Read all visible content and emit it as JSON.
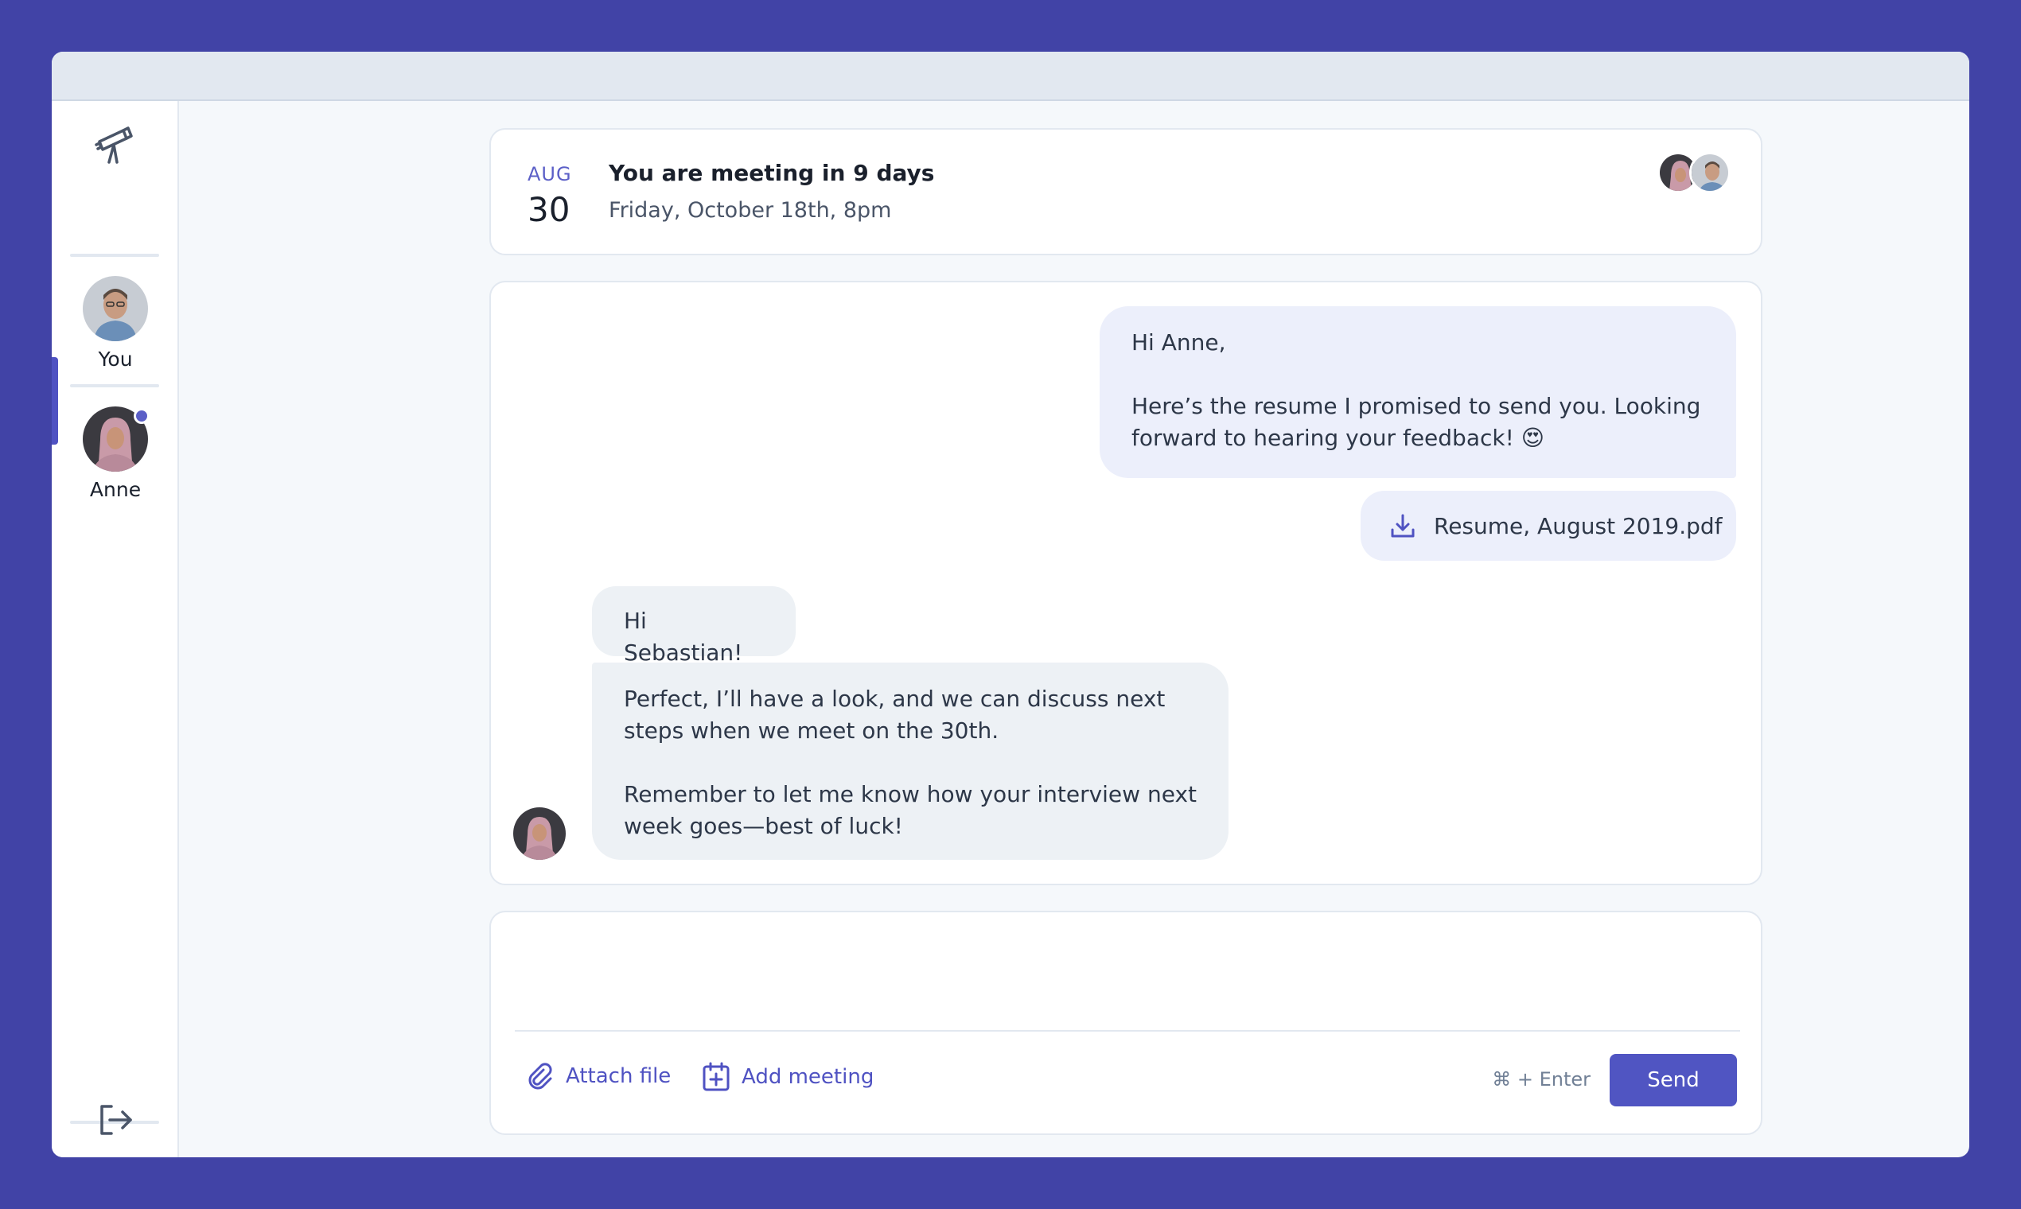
{
  "sidebar": {
    "logo_icon": "telescope-icon",
    "contacts": [
      {
        "name": "You"
      },
      {
        "name": "Anne",
        "online": true
      }
    ],
    "logout_icon": "logout-icon"
  },
  "meeting": {
    "month": "AUG",
    "day": "30",
    "title": "You are meeting in 9 days",
    "subtitle": "Friday, October 18th, 8pm"
  },
  "messages": {
    "outgoing_text": "Hi Anne,\n\nHere’s the resume I promised to send you. Looking forward to hearing your feedback! 😍",
    "attachment_name": "Resume, August 2019.pdf",
    "attachment_icon": "download-icon",
    "incoming_1": "Hi Sebastian!",
    "incoming_2": "Perfect, I’ll have a look, and we can discuss next steps when we meet on the 30th.\n\nRemember to let me know how your interview next week goes—best of luck!"
  },
  "compose": {
    "placeholder": "",
    "attach_label": "Attach file",
    "attach_icon": "paperclip-icon",
    "meeting_label": "Add meeting",
    "meeting_icon": "calendar-plus-icon",
    "hint": "⌘ + Enter",
    "send_label": "Send"
  },
  "colors": {
    "background": "#4143a6",
    "accent": "#5055c2",
    "outgoing_bubble": "#eceffb",
    "incoming_bubble": "#edf1f5"
  }
}
